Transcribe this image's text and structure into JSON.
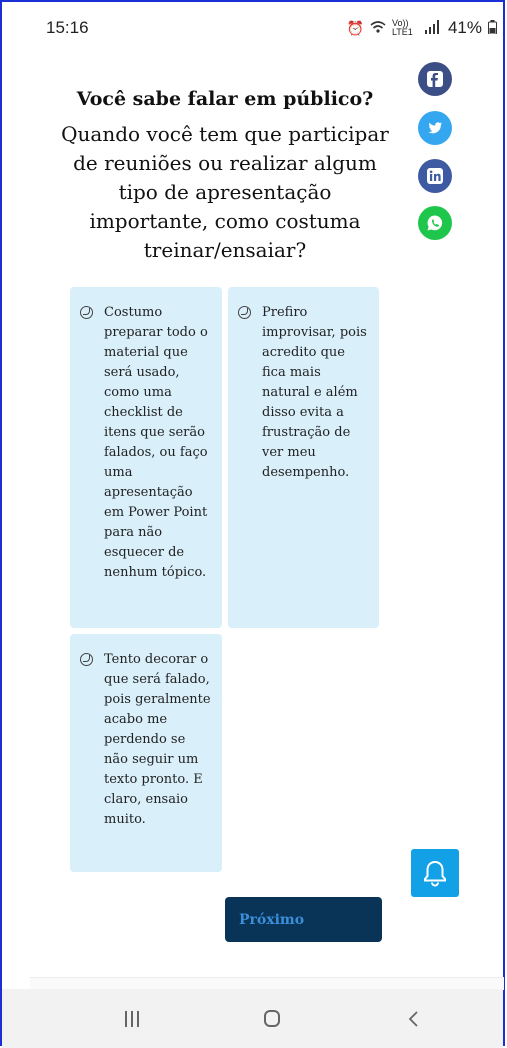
{
  "status_bar": {
    "time": "15:16",
    "network_label": "Vo)) LTE1",
    "battery": "41%"
  },
  "quiz": {
    "title": "Você sabe falar em público?",
    "question": "Quando você tem que participar de reuniões ou realizar algum tipo de apresentação importante, como costuma treinar/ensaiar?",
    "options": [
      {
        "label": "Costumo preparar todo o material que será usado, como uma checklist de itens que serão falados, ou faço uma apresentação em Power Point para não esquecer de nenhum tópico."
      },
      {
        "label": "Prefiro improvisar, pois acredito que fica mais natural e além disso evita a frustração de ver meu desempenho."
      },
      {
        "label": "Tento decorar o que será falado, pois geralmente acabo me perdendo se não seguir um texto pronto. E claro, ensaio muito."
      }
    ],
    "next_label": "Próximo"
  },
  "social": [
    "facebook-icon",
    "twitter-icon",
    "linkedin-icon",
    "whatsapp-icon"
  ],
  "colors": {
    "option_bg": "#d9effa",
    "next_bg": "#0a3358",
    "bell_bg": "#12a0e6"
  }
}
